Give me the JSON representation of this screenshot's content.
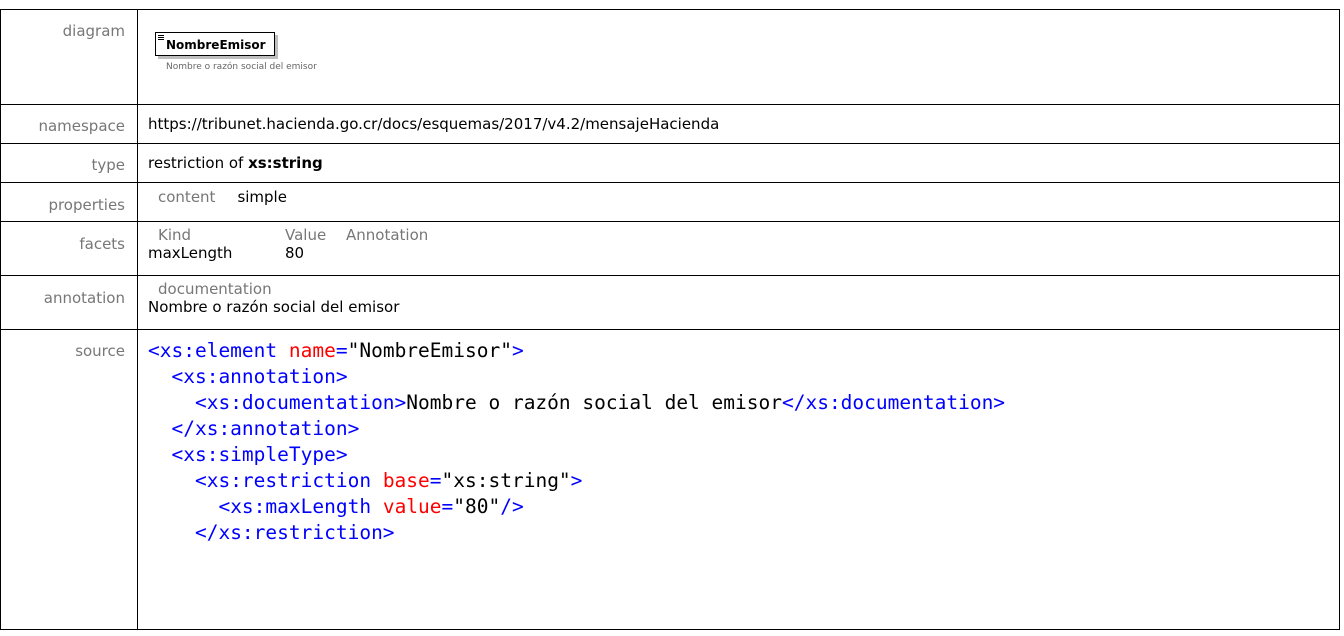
{
  "labels": {
    "diagram": "diagram",
    "namespace": "namespace",
    "type": "type",
    "properties": "properties",
    "facets": "facets",
    "annotation": "annotation",
    "source": "source"
  },
  "diagram": {
    "element_name": "NombreEmisor",
    "note": "Nombre o razón social del emisor"
  },
  "namespace": "https://tribunet.hacienda.go.cr/docs/esquemas/2017/v4.2/mensajeHacienda",
  "type": {
    "prefix": "restriction of ",
    "base": "xs:string"
  },
  "properties": {
    "key": "content",
    "value": "simple"
  },
  "facets": {
    "headers": [
      "Kind",
      "Value",
      "Annotation"
    ],
    "rows": [
      {
        "kind": "maxLength",
        "value": "80",
        "annotation": ""
      }
    ]
  },
  "annotation": {
    "header": "documentation",
    "text": "Nombre o razón social del emisor"
  },
  "source": {
    "lines": [
      [
        {
          "t": "tag",
          "v": "<xs:element "
        },
        {
          "t": "attr",
          "v": "name"
        },
        {
          "t": "sym",
          "v": "="
        },
        {
          "t": "txt",
          "v": "\"NombreEmisor\""
        },
        {
          "t": "sym",
          "v": ">"
        }
      ],
      [
        {
          "t": "txt",
          "v": "  "
        },
        {
          "t": "tag",
          "v": "<xs:annotation>"
        }
      ],
      [
        {
          "t": "txt",
          "v": "    "
        },
        {
          "t": "tag",
          "v": "<xs:documentation>"
        },
        {
          "t": "txt",
          "v": "Nombre o razón social del emisor"
        },
        {
          "t": "tag",
          "v": "</xs:documentation>"
        }
      ],
      [
        {
          "t": "txt",
          "v": "  "
        },
        {
          "t": "tag",
          "v": "</xs:annotation>"
        }
      ],
      [
        {
          "t": "txt",
          "v": "  "
        },
        {
          "t": "tag",
          "v": "<xs:simpleType>"
        }
      ],
      [
        {
          "t": "txt",
          "v": "    "
        },
        {
          "t": "tag",
          "v": "<xs:restriction "
        },
        {
          "t": "attr",
          "v": "base"
        },
        {
          "t": "sym",
          "v": "="
        },
        {
          "t": "txt",
          "v": "\"xs:string\""
        },
        {
          "t": "sym",
          "v": ">"
        }
      ],
      [
        {
          "t": "txt",
          "v": "      "
        },
        {
          "t": "tag",
          "v": "<xs:maxLength "
        },
        {
          "t": "attr",
          "v": "value"
        },
        {
          "t": "sym",
          "v": "="
        },
        {
          "t": "txt",
          "v": "\"80\""
        },
        {
          "t": "sym",
          "v": "/>"
        }
      ],
      [
        {
          "t": "txt",
          "v": "    "
        },
        {
          "t": "tag",
          "v": "</xs:restriction>"
        }
      ]
    ]
  },
  "colors": {
    "tag": "#0000ff",
    "attr": "#ff0000",
    "label": "#777777"
  }
}
